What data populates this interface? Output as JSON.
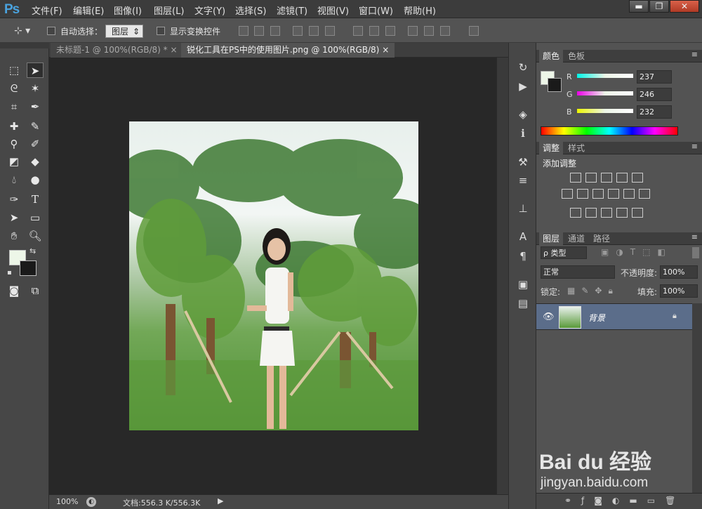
{
  "app": {
    "logo": "Ps"
  },
  "menu": [
    "文件(F)",
    "编辑(E)",
    "图像(I)",
    "图层(L)",
    "文字(Y)",
    "选择(S)",
    "滤镜(T)",
    "视图(V)",
    "窗口(W)",
    "帮助(H)"
  ],
  "window_controls": {
    "minimize": "▬",
    "restore": "❐",
    "close": "✕"
  },
  "options": {
    "auto_select_label": "自动选择：",
    "auto_select_value": "图层",
    "show_transform_label": "显示变换控件"
  },
  "tabs": [
    {
      "label": "未标题-1 @ 100%(RGB/8) *",
      "close": "×"
    },
    {
      "label": "锐化工具在PS中的使用图片.png @ 100%(RGB/8)",
      "close": "×"
    }
  ],
  "status": {
    "zoom": "100%",
    "doc": "文档:556.3 K/556.3K"
  },
  "color_panel": {
    "tabs": [
      "颜色",
      "色板"
    ],
    "r_label": "R",
    "g_label": "G",
    "b_label": "B",
    "r": "237",
    "g": "246",
    "b": "232",
    "fg": "#edf6e8",
    "bg": "#1a1a1a"
  },
  "adjust_panel": {
    "tabs": [
      "调整",
      "样式"
    ],
    "title": "添加调整"
  },
  "layers_panel": {
    "tabs": [
      "图层",
      "通道",
      "路径"
    ],
    "filter_label": "ρ 类型",
    "blend_mode": "正常",
    "opacity_label": "不透明度:",
    "opacity": "100%",
    "lock_label": "锁定:",
    "fill_label": "填充:",
    "fill": "100%",
    "layer_name": "背景"
  },
  "watermark": {
    "brand": "Bai du 经验",
    "url": "jingyan.baidu.com"
  }
}
